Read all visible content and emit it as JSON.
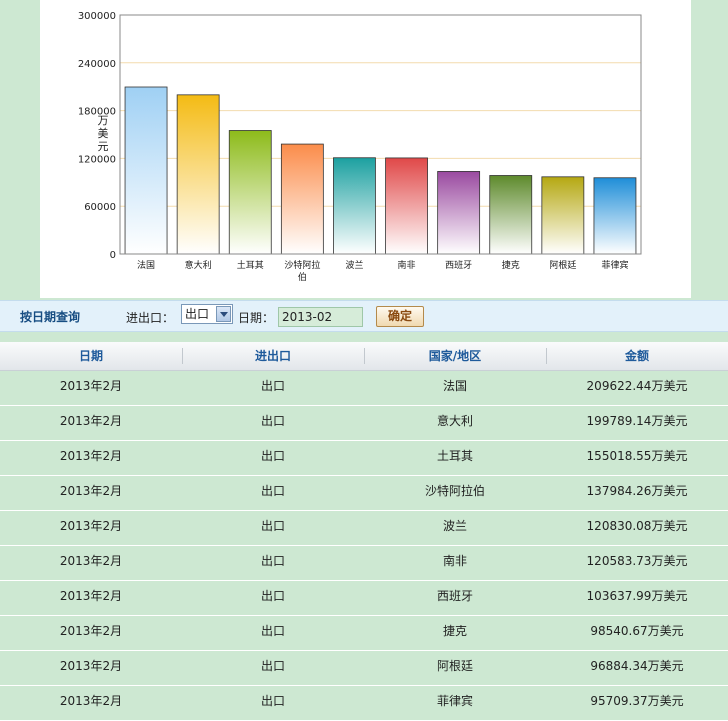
{
  "chart_data": {
    "type": "bar",
    "ylabel": "万美元",
    "ylim": [
      0,
      300000
    ],
    "yticks": [
      "0",
      "60000",
      "120000",
      "180000",
      "240000",
      "300000"
    ],
    "categories": [
      "法国",
      "意大利",
      "土耳其",
      "沙特阿拉伯",
      "波兰",
      "南非",
      "西班牙",
      "捷克",
      "阿根廷",
      "菲律宾"
    ],
    "values": [
      209622.44,
      199789.14,
      155018.55,
      137984.26,
      120830.08,
      120583.73,
      103637.99,
      98540.67,
      96884.34,
      95709.37
    ],
    "colors": [
      "#9fd0f4",
      "#f4bb14",
      "#8dbb1a",
      "#fb8c4a",
      "#1ca0a0",
      "#e04848",
      "#9a4aa0",
      "#5e8a2c",
      "#b5a812",
      "#1f8ed8"
    ],
    "grid": true
  },
  "query": {
    "title": "按日期查询",
    "direction_label": "进出口：",
    "direction_value": "出口",
    "date_label": "日期：",
    "date_value": "2013-02",
    "ok_label": "确定"
  },
  "table": {
    "headers": [
      "日期",
      "进出口",
      "国家/地区",
      "金额"
    ],
    "rows": [
      [
        "2013年2月",
        "出口",
        "法国",
        "209622.44万美元"
      ],
      [
        "2013年2月",
        "出口",
        "意大利",
        "199789.14万美元"
      ],
      [
        "2013年2月",
        "出口",
        "土耳其",
        "155018.55万美元"
      ],
      [
        "2013年2月",
        "出口",
        "沙特阿拉伯",
        "137984.26万美元"
      ],
      [
        "2013年2月",
        "出口",
        "波兰",
        "120830.08万美元"
      ],
      [
        "2013年2月",
        "出口",
        "南非",
        "120583.73万美元"
      ],
      [
        "2013年2月",
        "出口",
        "西班牙",
        "103637.99万美元"
      ],
      [
        "2013年2月",
        "出口",
        "捷克",
        "98540.67万美元"
      ],
      [
        "2013年2月",
        "出口",
        "阿根廷",
        "96884.34万美元"
      ],
      [
        "2013年2月",
        "出口",
        "菲律宾",
        "95709.37万美元"
      ]
    ]
  }
}
